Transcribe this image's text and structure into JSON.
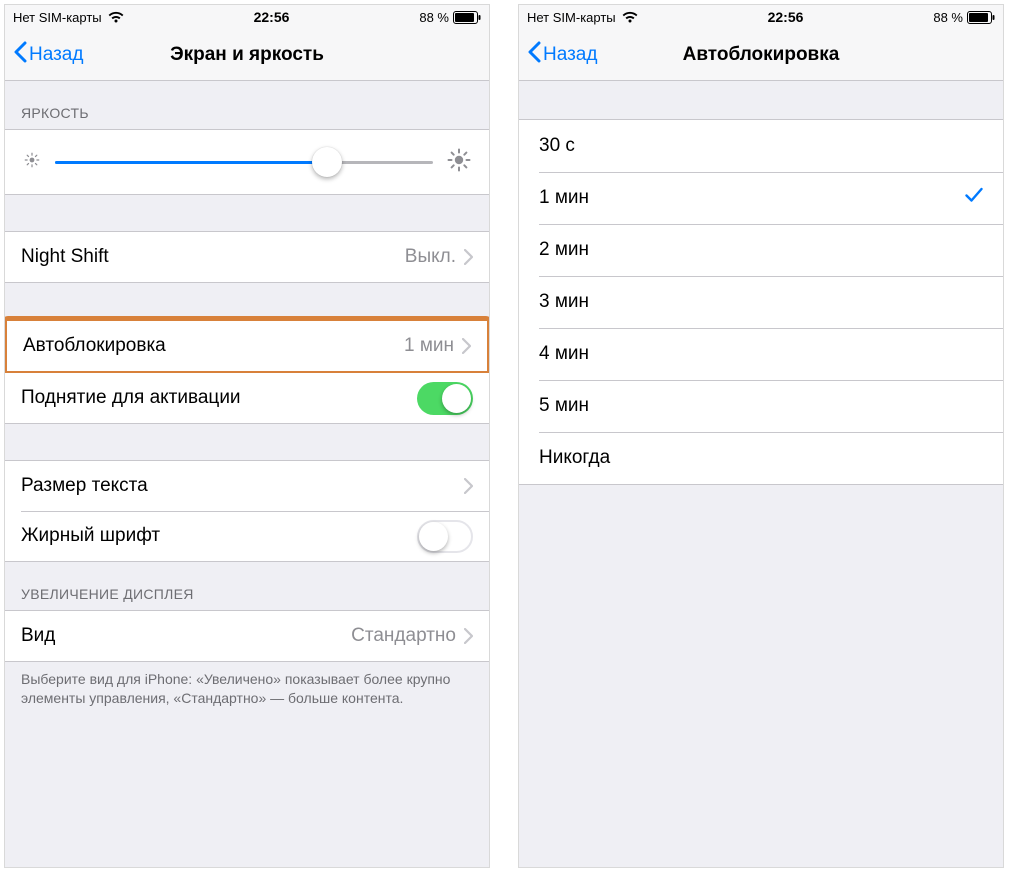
{
  "status": {
    "carrier": "Нет SIM-карты",
    "time": "22:56",
    "battery_pct": "88 %"
  },
  "left": {
    "back_label": "Назад",
    "title": "Экран и яркость",
    "brightness_header": "ЯРКОСТЬ",
    "brightness_percent": 72,
    "night_shift": {
      "label": "Night Shift",
      "value": "Выкл."
    },
    "autolock": {
      "label": "Автоблокировка",
      "value": "1 мин"
    },
    "raise_to_wake": {
      "label": "Поднятие для активации",
      "on": true
    },
    "text_size": {
      "label": "Размер текста"
    },
    "bold_text": {
      "label": "Жирный шрифт",
      "on": false
    },
    "display_zoom_header": "УВЕЛИЧЕНИЕ ДИСПЛЕЯ",
    "view": {
      "label": "Вид",
      "value": "Стандартно"
    },
    "view_footer": "Выберите вид для iPhone: «Увеличено» показывает более крупно элементы управления, «Стандартно» — больше контента."
  },
  "right": {
    "back_label": "Назад",
    "title": "Автоблокировка",
    "options": [
      {
        "label": "30 с",
        "selected": false
      },
      {
        "label": "1 мин",
        "selected": true
      },
      {
        "label": "2 мин",
        "selected": false
      },
      {
        "label": "3 мин",
        "selected": false
      },
      {
        "label": "4 мин",
        "selected": false
      },
      {
        "label": "5 мин",
        "selected": false
      },
      {
        "label": "Никогда",
        "selected": false
      }
    ]
  }
}
